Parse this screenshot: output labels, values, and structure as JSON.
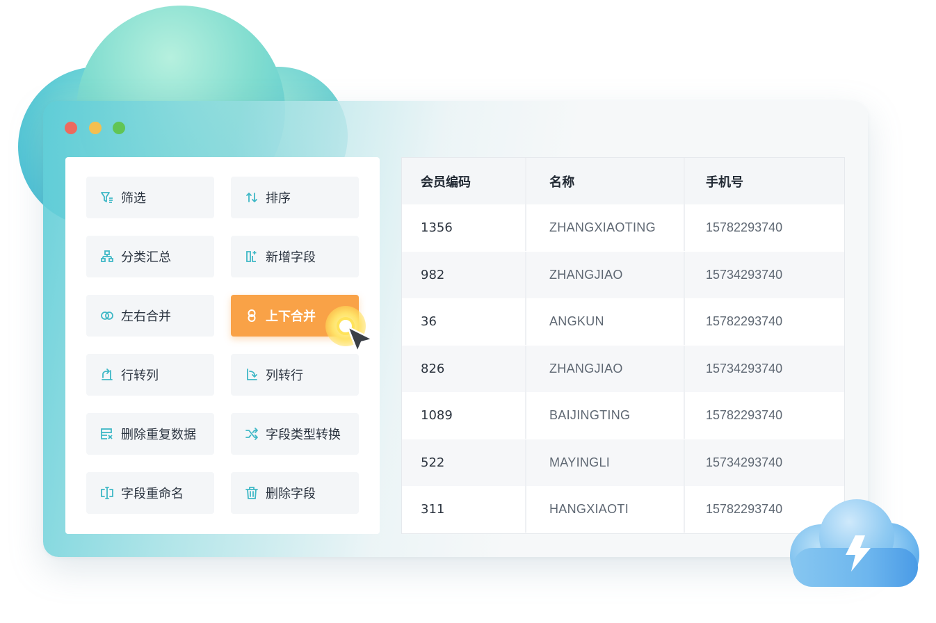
{
  "operations": [
    {
      "label": "筛选",
      "icon": "filter-icon"
    },
    {
      "label": "排序",
      "icon": "sort-icon"
    },
    {
      "label": "分类汇总",
      "icon": "group-summary-icon"
    },
    {
      "label": "新增字段",
      "icon": "add-field-icon"
    },
    {
      "label": "左右合并",
      "icon": "horizontal-merge-icon"
    },
    {
      "label": "上下合并",
      "icon": "vertical-merge-icon",
      "active": true
    },
    {
      "label": "行转列",
      "icon": "row-to-column-icon"
    },
    {
      "label": "列转行",
      "icon": "column-to-row-icon"
    },
    {
      "label": "删除重复数据",
      "icon": "remove-duplicates-icon"
    },
    {
      "label": "字段类型转换",
      "icon": "shuffle-icon"
    },
    {
      "label": "字段重命名",
      "icon": "rename-field-icon"
    },
    {
      "label": "删除字段",
      "icon": "trash-icon"
    }
  ],
  "table": {
    "headers": [
      "会员编码",
      "名称",
      "手机号"
    ],
    "rows": [
      [
        "1356",
        "ZHANGXIAOTING",
        "15782293740"
      ],
      [
        "982",
        "ZHANGJIAO",
        "15734293740"
      ],
      [
        "36",
        "ANGKUN",
        "15782293740"
      ],
      [
        "826",
        "ZHANGJIAO",
        "15734293740"
      ],
      [
        "1089",
        "BAIJINGTING",
        "15782293740"
      ],
      [
        "522",
        "MAYINGLI",
        "15734293740"
      ],
      [
        "311",
        "HANGXIAOTI",
        "15782293740"
      ]
    ]
  },
  "colors": {
    "accent_icon": "#3fb8c6",
    "active_button": "#f9a247",
    "window_dot_red": "#ec6a5e",
    "window_dot_yellow": "#f4bf4f",
    "window_dot_green": "#61c554"
  }
}
